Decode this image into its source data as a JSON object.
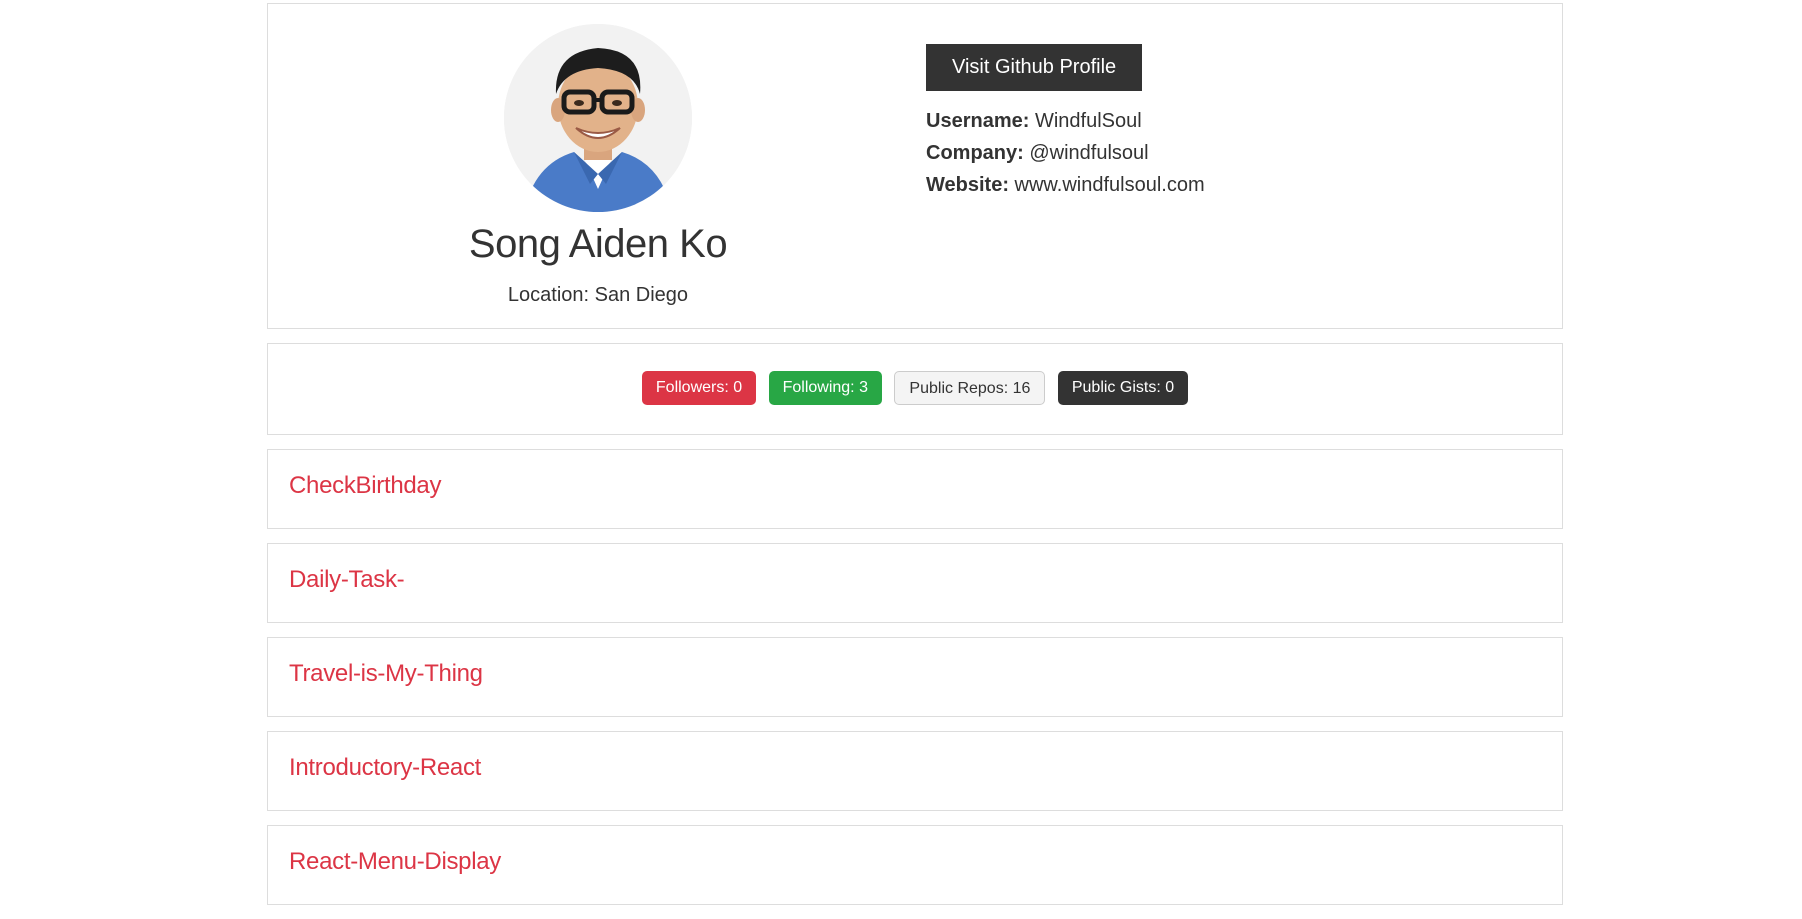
{
  "profile": {
    "name": "Song Aiden Ko",
    "location": "Location: San Diego",
    "visit_button": "Visit Github Profile",
    "info": [
      {
        "label": "Username:",
        "value": "WindfulSoul"
      },
      {
        "label": "Company:",
        "value": "@windfulsoul"
      },
      {
        "label": "Website:",
        "value": "www.windfulsoul.com"
      }
    ]
  },
  "stats": {
    "followers": "Followers: 0",
    "following": "Following: 3",
    "public_repos": "Public Repos: 16",
    "public_gists": "Public Gists: 0"
  },
  "repos": [
    "CheckBirthday",
    "Daily-Task-",
    "Travel-is-My-Thing",
    "Introductory-React",
    "React-Menu-Display"
  ],
  "colors": {
    "accent_red": "#dc3545",
    "accent_green": "#28a745",
    "dark": "#333333",
    "light": "#f4f4f4"
  }
}
